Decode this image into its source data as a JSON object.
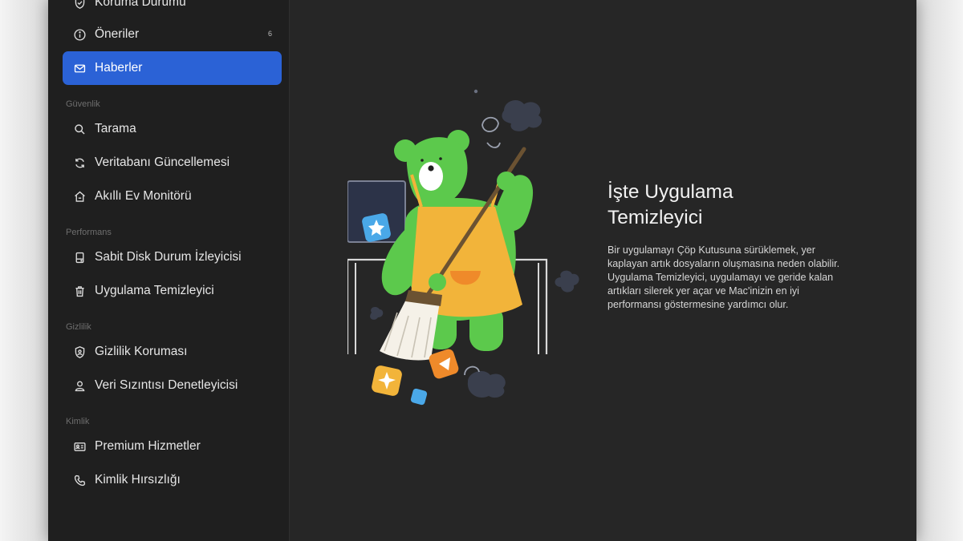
{
  "sidebar": {
    "top_items": [
      {
        "label": "Koruma Durumu",
        "icon": "shield-check-icon"
      },
      {
        "label": "Öneriler",
        "icon": "info-icon",
        "badge": "6"
      },
      {
        "label": "Haberler",
        "icon": "mail-icon",
        "active": true
      }
    ],
    "sections": [
      {
        "label": "Güvenlik",
        "items": [
          {
            "label": "Tarama",
            "icon": "search-icon"
          },
          {
            "label": "Veritabanı Güncellemesi",
            "icon": "refresh-icon"
          },
          {
            "label": "Akıllı Ev Monitörü",
            "icon": "home-icon"
          }
        ]
      },
      {
        "label": "Performans",
        "items": [
          {
            "label": "Sabit Disk Durum İzleyicisi",
            "icon": "disk-icon"
          },
          {
            "label": "Uygulama Temizleyici",
            "icon": "trash-icon"
          }
        ]
      },
      {
        "label": "Gizlilik",
        "items": [
          {
            "label": "Gizlilik Koruması",
            "icon": "privacy-shield-icon"
          },
          {
            "label": "Veri Sızıntısı Denetleyicisi",
            "icon": "user-icon"
          }
        ]
      },
      {
        "label": "Kimlik",
        "items": [
          {
            "label": "Premium Hizmetler",
            "icon": "id-card-icon"
          },
          {
            "label": "Kimlik Hırsızlığı",
            "icon": "phone-icon"
          }
        ]
      }
    ]
  },
  "main": {
    "feature_title": "İşte Uygulama Temizleyici",
    "feature_description": "Bir uygulamayı Çöp Kutusuna sürüklemek, yer kaplayan artık dosyaların oluşmasına neden olabilir. Uygulama Temizleyici, uygulamayı ve geride kalan artıkları silerek yer açar ve Mac'inizin en iyi performansı göstermesine yardımcı olur.",
    "illustration": "green-bear-sweeping-illustration"
  },
  "colors": {
    "accent": "#2b62d6",
    "sidebar_bg": "#1f1f1f",
    "main_bg": "#262626",
    "bear_green": "#5cc94c",
    "apron_yellow": "#f2b43a"
  }
}
